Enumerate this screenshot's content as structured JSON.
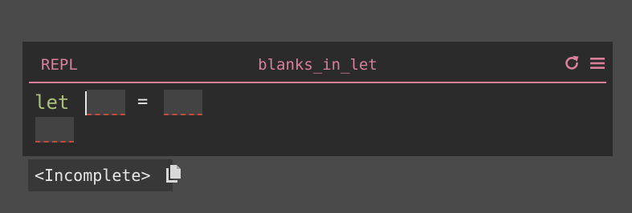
{
  "header": {
    "left_label": "REPL",
    "title": "blanks_in_let",
    "icons": [
      "refresh-icon",
      "menu-icon"
    ]
  },
  "code": {
    "keyword": "let",
    "operator": "="
  },
  "result": {
    "text": "<Incomplete>",
    "icon": "copy-icon"
  },
  "colors": {
    "accent": "#d9809b",
    "keyword": "#a8c07a",
    "hole_underline": "#c44a3a",
    "panel_bg": "#2b2b2b",
    "page_bg": "#4a4a4a"
  }
}
